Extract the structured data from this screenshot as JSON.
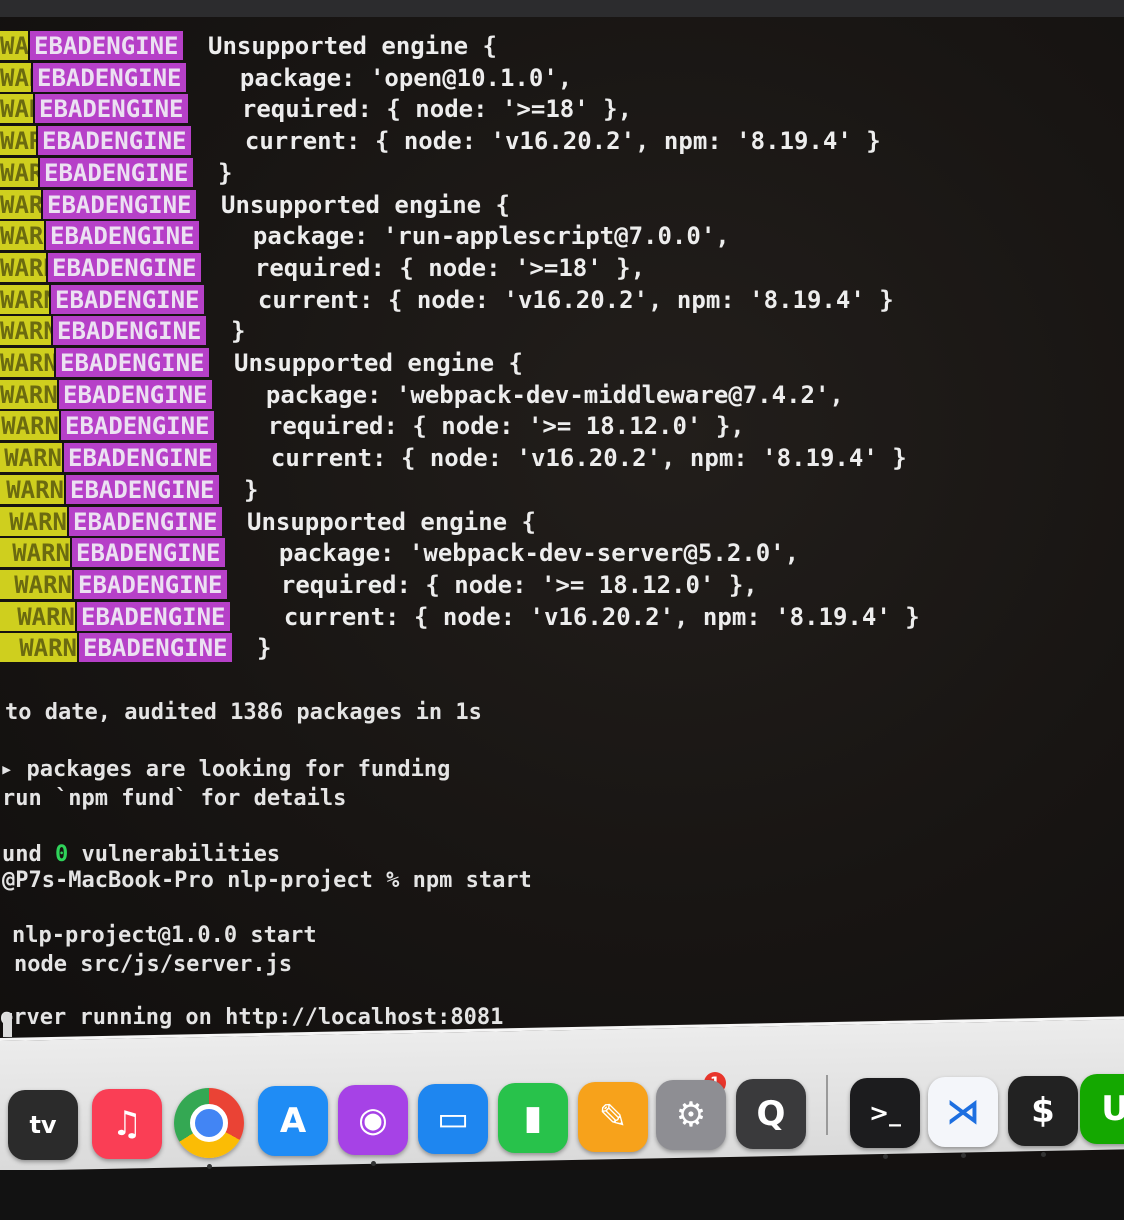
{
  "terminal": {
    "npm_warn": {
      "warn_label": "WARN",
      "code": "EBADENGINE",
      "lines": [
        "Unsupported engine {",
        "  package: 'open@10.1.0',",
        "  required: { node: '>=18' },",
        "  current: { node: 'v16.20.2', npm: '8.19.4' }",
        "}",
        "Unsupported engine {",
        "  package: 'run-applescript@7.0.0',",
        "  required: { node: '>=18' },",
        "  current: { node: 'v16.20.2', npm: '8.19.4' }",
        "}",
        "Unsupported engine {",
        "  package: 'webpack-dev-middleware@7.4.2',",
        "  required: { node: '>= 18.12.0' },",
        "  current: { node: 'v16.20.2', npm: '8.19.4' }",
        "}",
        "Unsupported engine {",
        "  package: 'webpack-dev-server@5.2.0',",
        "  required: { node: '>= 18.12.0' },",
        "  current: { node: 'v16.20.2', npm: '8.19.4' }",
        "}"
      ]
    },
    "audit_line": "to date, audited 1386 packages in 1s",
    "funding_line": "packages are looking for funding",
    "fund_details_line": "run `npm fund` for details",
    "vuln_prefix": "und",
    "vuln_count": "0",
    "vuln_suffix": "vulnerabilities",
    "prompt_line": "@P7s-MacBook-Pro nlp-project % npm start",
    "start_script_line": "nlp-project@1.0.0 start",
    "start_cmd_line": "node src/js/server.js",
    "server_line": "erver running on http://localhost:8081"
  },
  "dock": {
    "apps": [
      {
        "name": "Apple TV",
        "label": "tv",
        "color": "#2b2b2b"
      },
      {
        "name": "Music",
        "label": "♫",
        "color": "#fa3e55"
      },
      {
        "name": "Chrome",
        "label": "",
        "color": "#ffffff"
      },
      {
        "name": "App Store",
        "label": "A",
        "color": "#1f8cf5"
      },
      {
        "name": "Podcasts",
        "label": "◉",
        "color": "#a642e6"
      },
      {
        "name": "Keynote",
        "label": "▭",
        "color": "#1e86f0"
      },
      {
        "name": "Numbers",
        "label": "▮",
        "color": "#28c24b"
      },
      {
        "name": "Pages",
        "label": "✎",
        "color": "#f7a21b"
      },
      {
        "name": "System Settings",
        "label": "⚙",
        "color": "#8e8e93",
        "badge": "1"
      },
      {
        "name": "QuickTime Player",
        "label": "Q",
        "color": "#3a3a3c"
      },
      {
        "name": "Terminal",
        "label": ">_",
        "color": "#1c1c1e"
      },
      {
        "name": "Visual Studio Code",
        "label": "⋊",
        "color": "#f4f6fa"
      },
      {
        "name": "iTerm",
        "label": "$",
        "color": "#222"
      },
      {
        "name": "Upwork",
        "label": "U",
        "color": "#14a800"
      }
    ]
  }
}
